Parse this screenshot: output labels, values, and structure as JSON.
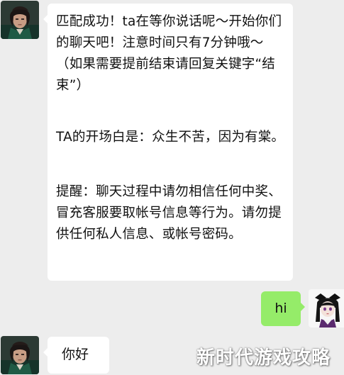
{
  "conversation": {
    "messages": [
      {
        "side": "incoming",
        "paragraphs": [
          "匹配成功！ta在等你说话呢～开始你们的聊天吧！注意时间只有7分钟哦～（如果需要提前结束请回复关键字“结束”）",
          "TA的开场白是：众生不苦，因为有棠。",
          "提醒：聊天过程中请勿相信任何中奖、冒充客服要取帐号信息等行为。请勿提供任何私人信息、或帐号密码。"
        ]
      },
      {
        "side": "outgoing",
        "text": "hi"
      },
      {
        "side": "incoming",
        "text": "你好"
      }
    ]
  },
  "watermark": {
    "text": "新时代游戏攻略"
  },
  "colors": {
    "background": "#ededed",
    "incoming_bubble": "#ffffff",
    "outgoing_bubble": "#95ec69",
    "text": "#111111"
  },
  "icons": {
    "incoming_avatar": "dark-haired-character-avatar-icon",
    "outgoing_avatar": "girl-with-black-hair-bows-avatar-icon"
  }
}
